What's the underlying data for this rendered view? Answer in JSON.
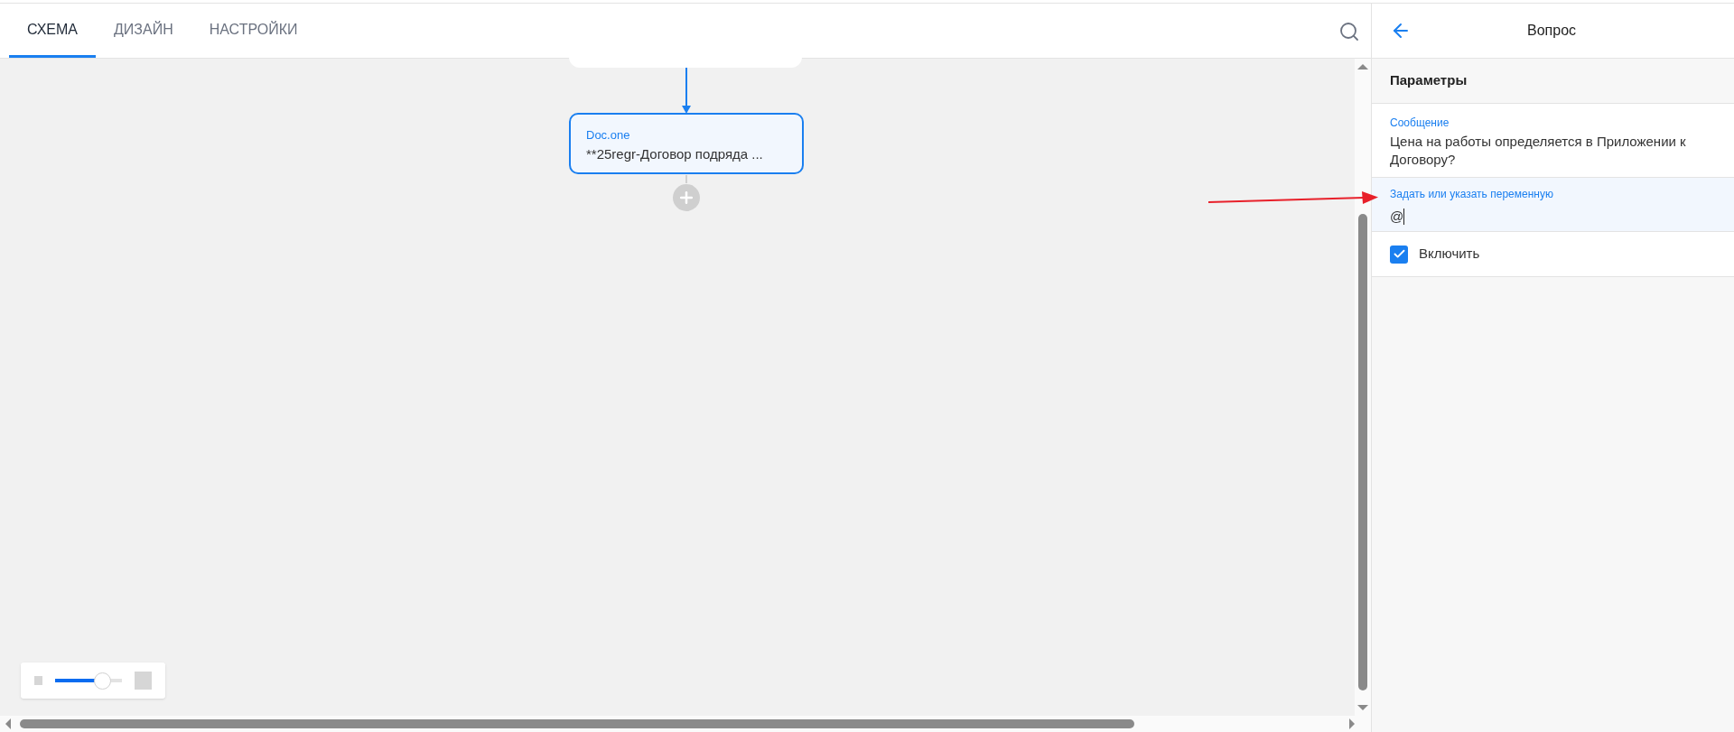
{
  "tabs": [
    {
      "label": "СХЕМА",
      "selected": true
    },
    {
      "label": "ДИЗАЙН",
      "selected": false
    },
    {
      "label": "НАСТРОЙКИ",
      "selected": false
    }
  ],
  "canvas": {
    "node": {
      "title": "Doc.one",
      "text": "**25regr-Договор подряда ...",
      "selected": true
    },
    "zoom": {
      "level": 0.7
    }
  },
  "panel": {
    "title": "Вопрос",
    "section": "Параметры",
    "message": {
      "label": "Сообщение",
      "value": "Цена на работы определяется в Приложении к Договору?"
    },
    "variable": {
      "label": "Задать или указать переменную",
      "value": "@",
      "focused": true
    },
    "checkbox": {
      "label": "Включить",
      "checked": true
    }
  }
}
